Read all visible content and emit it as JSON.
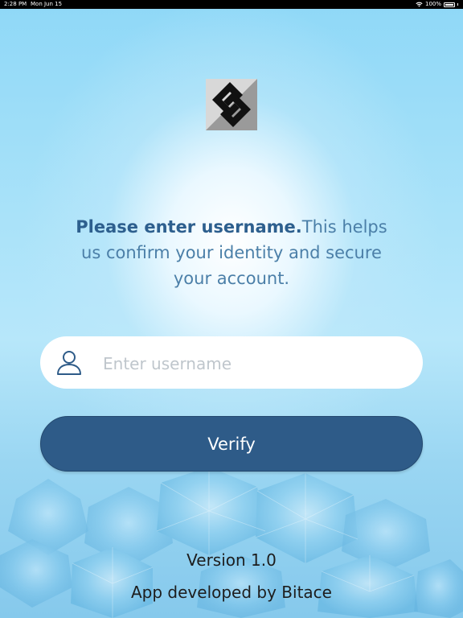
{
  "status_bar": {
    "time": "2:28 PM",
    "date": "Mon Jun 15",
    "battery": "100%",
    "wifi_icon": "wifi-icon",
    "battery_icon": "battery-icon"
  },
  "logo": {
    "icon": "brand-logo-s-icon"
  },
  "headline": {
    "bold": "Please enter username.",
    "rest": "This helps us confirm your identity and secure your account."
  },
  "username_field": {
    "placeholder": "Enter username",
    "value": "",
    "icon": "user-icon"
  },
  "verify_button": {
    "label": "Verify"
  },
  "footer": {
    "version": "Version 1.0",
    "developer": "App developed by Bitace"
  },
  "colors": {
    "primary": "#2e5b88",
    "headline_bold": "#2d5f8e",
    "headline_text": "#4b7fa8",
    "background": "#a9e2f9"
  }
}
